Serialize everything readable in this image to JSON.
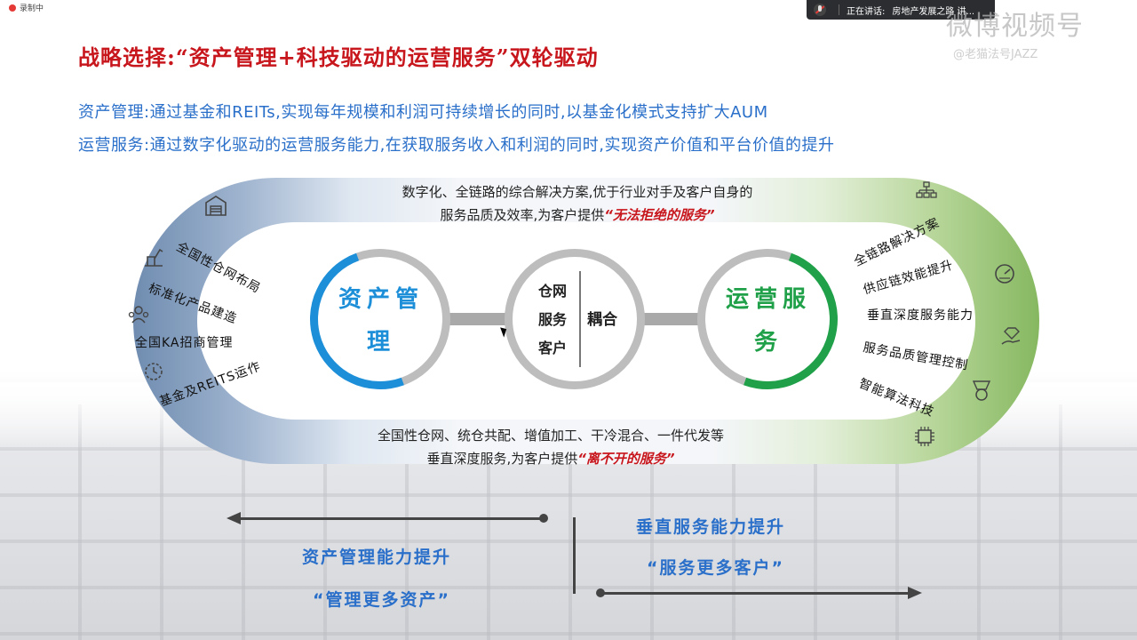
{
  "recording": {
    "label": "录制中"
  },
  "speaking": {
    "label": "正在讲话:",
    "name": "房地产发展之路 讲..."
  },
  "watermark": {
    "main": "微博视频号",
    "sub": "@老猫法号JAZZ"
  },
  "slide": {
    "title": "战略选择:“资产管理+科技驱动的运营服务”双轮驱动",
    "line1": "资产管理:通过基金和REITs,实现每年规模和利润可持续增长的同时,以基金化模式支持扩大AUM",
    "line2": "运营服务:通过数字化驱动的运营服务能力,在获取服务收入和利润的同时,实现资产价值和平台价值的提升",
    "top_text_1": "数字化、全链路的综合解决方案,优于行业对手及客户自身的",
    "top_text_2_prefix": "服务品质及效率,为客户提供",
    "top_text_2_em": "“无法拒绝的服务”",
    "bottom_text_1": "全国性仓网、统仓共配、增值加工、干冷混合、一件代发等",
    "bottom_text_2_prefix": "垂直深度服务,为客户提供",
    "bottom_text_2_em": "“离不开的服务”",
    "left_ring_label": "资产管理",
    "right_ring_label": "运营服务",
    "middle_items": [
      "仓网",
      "服务",
      "客户"
    ],
    "middle_couple": "耦合",
    "left_items": [
      "全国性仓网布局",
      "标准化产品建造",
      "全国KA招商管理",
      "基金及REITS运作"
    ],
    "right_items": [
      "全链路解决方案",
      "供应链效能提升",
      "垂直深度服务能力",
      "服务品质管理控制",
      "智能算法科技"
    ],
    "bottom_left_1": "资产管理能力提升",
    "bottom_left_2": "“管理更多资产”",
    "bottom_right_1": "垂直服务能力提升",
    "bottom_right_2": "“服务更多客户”"
  }
}
